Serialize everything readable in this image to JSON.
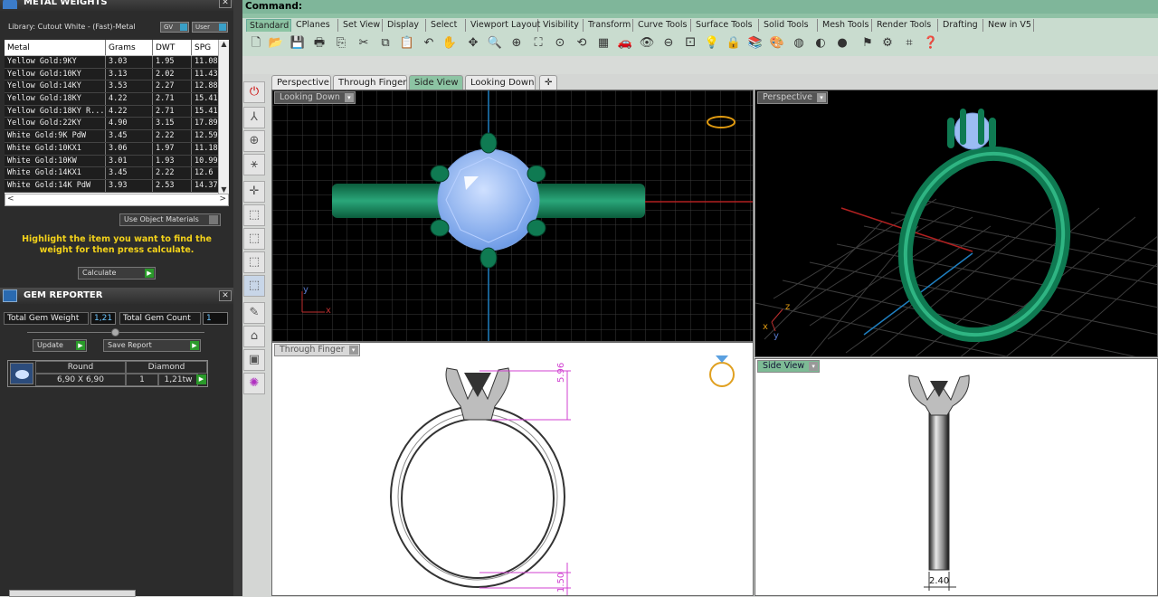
{
  "metal_panel": {
    "title": "METAL WEIGHTS",
    "library": "Library: Cutout White - (Fast)-Metal",
    "gv_toggle": "GV",
    "user_toggle": "User",
    "columns": [
      "Metal",
      "Grams",
      "DWT",
      "SPG"
    ],
    "rows": [
      [
        "Yellow Gold:9KY",
        "3.03",
        "1.95",
        "11.08"
      ],
      [
        "Yellow Gold:10KY",
        "3.13",
        "2.02",
        "11.43"
      ],
      [
        "Yellow Gold:14KY",
        "3.53",
        "2.27",
        "12.88"
      ],
      [
        "Yellow Gold:18KY",
        "4.22",
        "2.71",
        "15.41"
      ],
      [
        "Yellow Gold:18KY R...",
        "4.22",
        "2.71",
        "15.41"
      ],
      [
        "Yellow Gold:22KY",
        "4.90",
        "3.15",
        "17.89"
      ],
      [
        "White Gold:9K PdW",
        "3.45",
        "2.22",
        "12.59"
      ],
      [
        "White Gold:10KX1",
        "3.06",
        "1.97",
        "11.18"
      ],
      [
        "White Gold:10KW",
        "3.01",
        "1.93",
        "10.99"
      ],
      [
        "White Gold:14KX1",
        "3.45",
        "2.22",
        "12.6"
      ],
      [
        "White Gold:14K PdW",
        "3.93",
        "2.53",
        "14.37"
      ]
    ],
    "use_object_materials": "Use Object Materials",
    "hint": "Highlight the item you want to find the weight for then press calculate.",
    "calculate": "Calculate"
  },
  "gem_panel": {
    "title": "GEM REPORTER",
    "total_weight_label": "Total Gem Weight",
    "total_weight_value": "1,21",
    "total_count_label": "Total Gem Count",
    "total_count_value": "1",
    "update": "Update",
    "save_report": "Save Report",
    "gem": {
      "shape": "Round",
      "type": "Diamond",
      "size": "6,90 X 6,90",
      "count": "1",
      "weight": "1,21tw"
    }
  },
  "command": {
    "label": "Command:"
  },
  "toolbar_tabs": [
    "Standard",
    "CPlanes",
    "Set View",
    "Display",
    "Select",
    "Viewport Layout",
    "Visibility",
    "Transform",
    "Curve Tools",
    "Surface Tools",
    "Solid Tools",
    "Mesh Tools",
    "Render Tools",
    "Drafting",
    "New in V5"
  ],
  "viewport_tabs": [
    "Perspective",
    "Through Finger",
    "Side View",
    "Looking Down"
  ],
  "viewports": {
    "top_left": "Looking Down",
    "top_right": "Perspective",
    "bottom_left": "Through Finger",
    "bottom_right": "Side View"
  },
  "dimensions": {
    "head_height": "5.96",
    "band_thickness": "1.50",
    "band_width": "2.40"
  },
  "axis_labels": {
    "x": "x",
    "y": "y",
    "z": "z"
  },
  "colors": {
    "command_bar": "#7fb69a",
    "ring_green": "#0f7a52",
    "gem_blue": "#8fb4ee",
    "dimension_magenta": "#d040d0",
    "hint_yellow": "#f3d21a"
  }
}
